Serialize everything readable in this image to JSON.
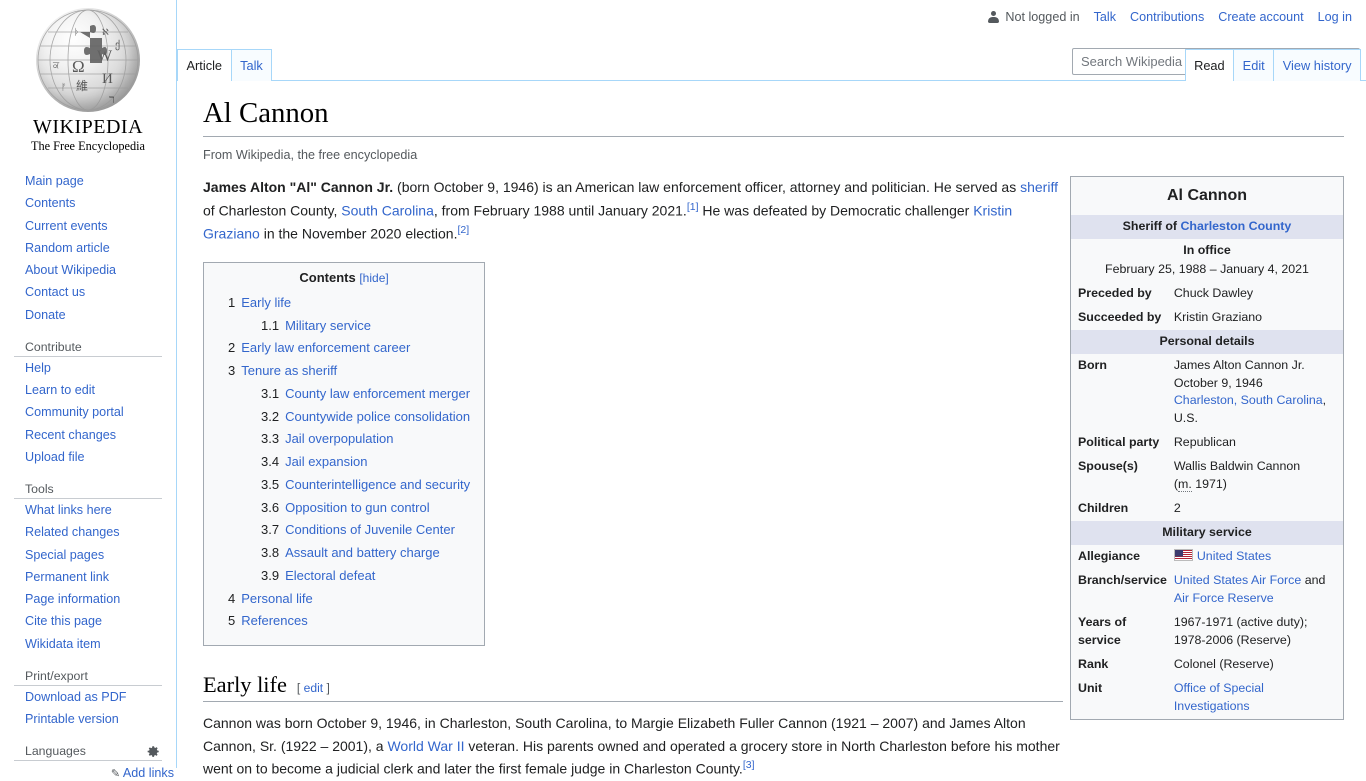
{
  "personal_bar": {
    "user_icon": "user-icon",
    "not_logged_in": "Not logged in",
    "links": [
      "Talk",
      "Contributions",
      "Create account",
      "Log in"
    ]
  },
  "sidebar": {
    "logo": {
      "wordmark": "WIKIPEDIA",
      "tagline": "The Free Encyclopedia"
    },
    "navigation": {
      "items": [
        "Main page",
        "Contents",
        "Current events",
        "Random article",
        "About Wikipedia",
        "Contact us",
        "Donate"
      ]
    },
    "contribute": {
      "heading": "Contribute",
      "items": [
        "Help",
        "Learn to edit",
        "Community portal",
        "Recent changes",
        "Upload file"
      ]
    },
    "tools": {
      "heading": "Tools",
      "items": [
        "What links here",
        "Related changes",
        "Special pages",
        "Permanent link",
        "Page information",
        "Cite this page",
        "Wikidata item"
      ]
    },
    "print_export": {
      "heading": "Print/export",
      "items": [
        "Download as PDF",
        "Printable version"
      ]
    },
    "languages": {
      "heading": "Languages",
      "gear_icon": "gear-icon",
      "add_links": "Add links",
      "pencil_icon": "pencil-icon"
    }
  },
  "namespace_tabs": [
    {
      "label": "Article",
      "selected": true
    },
    {
      "label": "Talk",
      "selected": false
    }
  ],
  "view_tabs": [
    {
      "label": "Read",
      "selected": true
    },
    {
      "label": "Edit",
      "selected": false
    },
    {
      "label": "View history",
      "selected": false
    }
  ],
  "search": {
    "placeholder": "Search Wikipedia",
    "value": "",
    "icon": "search-icon"
  },
  "article": {
    "title": "Al Cannon",
    "site_sub": "From Wikipedia, the free encyclopedia",
    "lead": {
      "bold_name": "James Alton \"Al\" Cannon Jr.",
      "t1": " (born October 9, 1946) is an American law enforcement officer, attorney and politician. He served as ",
      "link1": "sheriff",
      "t2": " of Charleston County, ",
      "link2": "South Carolina",
      "t3": ", from February 1988 until January 2021.",
      "ref1": "[1]",
      "t4": " He was defeated by Democratic challenger ",
      "link3": "Kristin Graziano",
      "t5": " in the November 2020 election.",
      "ref2": "[2]"
    },
    "toc": {
      "title": "Contents",
      "toggle": "[hide]",
      "entries": [
        {
          "num": "1",
          "text": "Early life",
          "level": 1
        },
        {
          "num": "1.1",
          "text": "Military service",
          "level": 2
        },
        {
          "num": "2",
          "text": "Early law enforcement career",
          "level": 1
        },
        {
          "num": "3",
          "text": "Tenure as sheriff",
          "level": 1
        },
        {
          "num": "3.1",
          "text": "County law enforcement merger",
          "level": 2
        },
        {
          "num": "3.2",
          "text": "Countywide police consolidation",
          "level": 2
        },
        {
          "num": "3.3",
          "text": "Jail overpopulation",
          "level": 2
        },
        {
          "num": "3.4",
          "text": "Jail expansion",
          "level": 2
        },
        {
          "num": "3.5",
          "text": "Counterintelligence and security",
          "level": 2
        },
        {
          "num": "3.6",
          "text": "Opposition to gun control",
          "level": 2
        },
        {
          "num": "3.7",
          "text": "Conditions of Juvenile Center",
          "level": 2
        },
        {
          "num": "3.8",
          "text": "Assault and battery charge",
          "level": 2
        },
        {
          "num": "3.9",
          "text": "Electoral defeat",
          "level": 2
        },
        {
          "num": "4",
          "text": "Personal life",
          "level": 1
        },
        {
          "num": "5",
          "text": "References",
          "level": 1
        }
      ]
    },
    "section1": {
      "heading": "Early life",
      "edit_open": "[ ",
      "edit": "edit",
      "edit_close": " ]",
      "p1_a": "Cannon was born October 9, 1946, in Charleston, South Carolina, to Margie Elizabeth Fuller Cannon (1921 – 2007) and James Alton Cannon, Sr. (1922 – 2001), a ",
      "p1_link": "World War II",
      "p1_b": " veteran. His parents owned and operated a grocery store in North Charleston before his mother went on to become a judicial clerk and later the first female judge in Charleston County.",
      "p1_ref": "[3]"
    }
  },
  "infobox": {
    "title": "Al Cannon",
    "office_prefix": "Sheriff of ",
    "office_link": "Charleston County",
    "in_office_label": "In office",
    "in_office_dates": "February 25, 1988 – January 4, 2021",
    "preceded_by_label": "Preceded by",
    "preceded_by": "Chuck Dawley",
    "succeeded_by_label": "Succeeded by",
    "succeeded_by": "Kristin Graziano",
    "personal_details_header": "Personal details",
    "born_label": "Born",
    "born_name": "James Alton Cannon Jr.",
    "born_date": "October 9, 1946",
    "born_place_link": "Charleston, South Carolina",
    "born_place_rest": ", U.S.",
    "party_label": "Political party",
    "party": "Republican",
    "spouse_label": "Spouse(s)",
    "spouse": "Wallis Baldwin Cannon",
    "spouse_marriage": "1971",
    "spouse_m": "m.",
    "children_label": "Children",
    "children": "2",
    "military_header": "Military service",
    "allegiance_label": "Allegiance",
    "allegiance": "United States",
    "allegiance_flag_icon": "us-flag-icon",
    "branch_label": "Branch/service",
    "branch_link1": "United States Air Force",
    "branch_and": " and ",
    "branch_link2": "Air Force Reserve",
    "years_label": "Years of service",
    "years_line1": "1967-1971 (active duty);",
    "years_line2": "1978-2006 (Reserve)",
    "rank_label": "Rank",
    "rank": "Colonel (Reserve)",
    "unit_label": "Unit",
    "unit_link": "Office of Special Investigations"
  },
  "colors": {
    "link": "#3366cc",
    "tab_border": "#a7d7f9",
    "infobox_bg": "#f8f9fa",
    "infobox_header_bg": "#dfe2ef",
    "rule": "#a2a9b1"
  }
}
